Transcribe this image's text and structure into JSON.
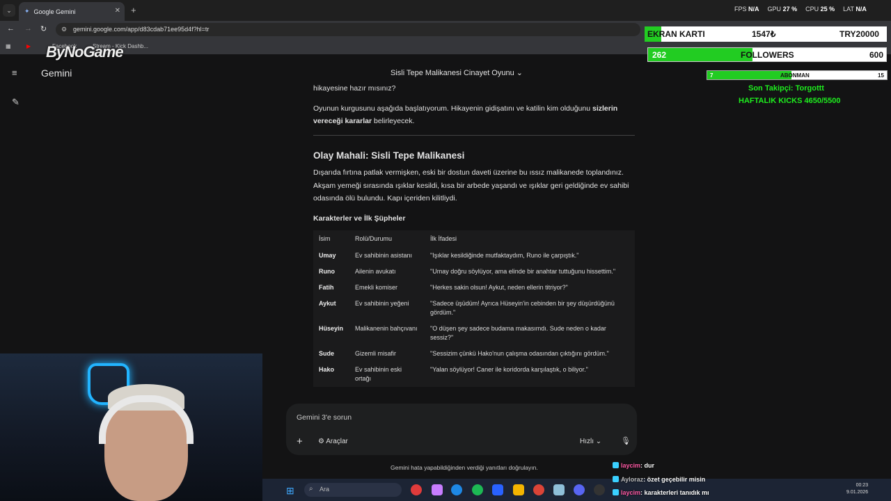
{
  "browser": {
    "tab_title": "Google Gemini",
    "url": "gemini.google.com/app/d83cdab71ee95d4f?hl=tr",
    "bookmarks": [
      "Facebook",
      "Stream - Kick Dashb..."
    ]
  },
  "stats": {
    "fps_label": "FPS",
    "fps": "N/A",
    "gpu_label": "GPU",
    "gpu": "27 %",
    "cpu_label": "CPU",
    "cpu": "25 %",
    "lat_label": "LAT",
    "lat": "N/A"
  },
  "stream_logo": "ByNoGame",
  "gemini": {
    "app_name": "Gemini",
    "conversation_title": "Sisli Tepe Malikanesi Cinayet Oyunu",
    "partial_line": "hikayesine hazır mısınız?",
    "intro_start": "Oyunun kurgusunu aşağıda başlatıyorum. Hikayenin gidişatını ve katilin kim olduğunu ",
    "intro_bold": "sizlerin vereceği kararlar",
    "intro_end": " belirleyecek.",
    "scene_heading": "Olay Mahali: Sisli Tepe Malikanesi",
    "scene_text": "Dışarıda fırtına patlak vermişken, eski bir dostun daveti üzerine bu ıssız malikanede toplandınız. Akşam yemeği sırasında ışıklar kesildi, kısa bir arbede yaşandı ve ışıklar geri geldiğinde ev sahibi odasında ölü bulundu. Kapı içeriden kilitliydi.",
    "characters_heading": "Karakterler ve İlk Şüpheler",
    "table_headers": [
      "İsim",
      "Rolü/Durumu",
      "İlk İfadesi"
    ],
    "table_rows": [
      {
        "name": "Umay",
        "role": "Ev sahibinin asistanı",
        "statement": "\"Işıklar kesildiğinde mutfaktaydım, Runo ile çarpıştık.\""
      },
      {
        "name": "Runo",
        "role": "Ailenin avukatı",
        "statement": "\"Umay doğru söylüyor, ama elinde bir anahtar tuttuğunu hissettim.\""
      },
      {
        "name": "Fatih",
        "role": "Emekli komiser",
        "statement": "\"Herkes sakin olsun! Aykut, neden ellerin titriyor?\""
      },
      {
        "name": "Aykut",
        "role": "Ev sahibinin yeğeni",
        "statement": "\"Sadece üşüdüm! Ayrıca Hüseyin'in cebinden bir şey düşürdüğünü gördüm.\""
      },
      {
        "name": "Hüseyin",
        "role": "Malikanenin bahçıvanı",
        "statement": "\"O düşen şey sadece budama makasımdı. Sude neden o kadar sessiz?\""
      },
      {
        "name": "Sude",
        "role": "Gizemli misafir",
        "statement": "\"Sessizim çünkü Hako'nun çalışma odasından çıktığını gördüm.\""
      },
      {
        "name": "Hako",
        "role": "Ev sahibinin eski ortağı",
        "statement": "\"Yalan söylüyor! Caner ile koridorda karşılaştık, o biliyor.\""
      }
    ],
    "input_placeholder": "Gemini 3'e sorun",
    "tools_label": "Araçlar",
    "mode_label": "Hızlı",
    "disclaimer": "Gemini hata yapabildiğinden verdiği yanıtları doğrulayın."
  },
  "overlay": {
    "card_left": "EKRAN KARTI",
    "card_mid": "1547₺",
    "card_right": "TRY20000",
    "followers_count": "262",
    "followers_label": "FOLLOWERS",
    "followers_goal": "600",
    "followers_progress": 0.44,
    "sub_left": "7",
    "sub_label": "ABONMAN",
    "sub_right": "15",
    "sub_progress": 0.47,
    "last_follower": "Son Takipçi: Torgottt",
    "weekly_kicks": "HAFTALIK KICKS 4650/5500"
  },
  "chat": [
    {
      "user": "laycim",
      "message": ": dur"
    },
    {
      "user": "Ayloraz",
      "message": ": özet geçebilir misin"
    },
    {
      "user": "laycim",
      "message": ": karakterleri tanıdık mı"
    }
  ],
  "taskbar": {
    "search_label": "Ara",
    "time": "00:23",
    "date": "9.01.2026"
  },
  "colors": {
    "accent_green": "#22cc22",
    "gemini_bg": "#131314",
    "taskbar": "#1c2434"
  }
}
